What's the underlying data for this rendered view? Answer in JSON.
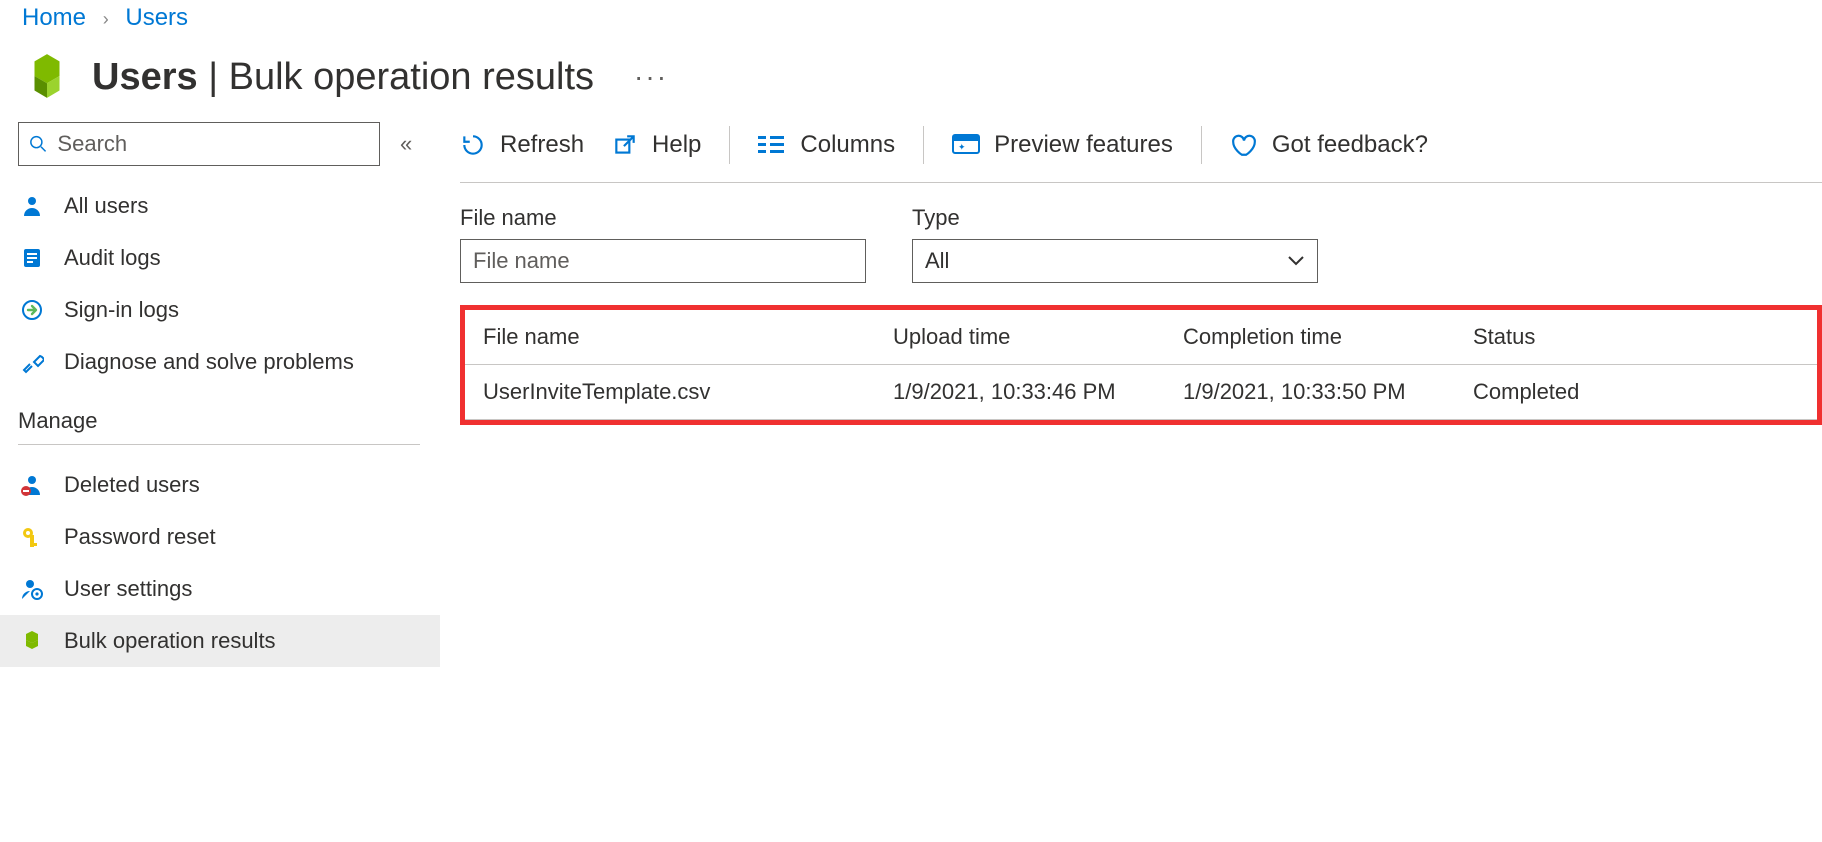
{
  "breadcrumb": {
    "home": "Home",
    "users": "Users"
  },
  "title": {
    "strong": "Users",
    "rest": " | Bulk operation results",
    "more": "···"
  },
  "sidebar": {
    "search_placeholder": "Search",
    "items": {
      "all_users": "All users",
      "audit_logs": "Audit logs",
      "signin_logs": "Sign-in logs",
      "diagnose": "Diagnose and solve problems"
    },
    "manage_header": "Manage",
    "manage": {
      "deleted_users": "Deleted users",
      "password_reset": "Password reset",
      "user_settings": "User settings",
      "bulk_results": "Bulk operation results"
    }
  },
  "toolbar": {
    "refresh": "Refresh",
    "help": "Help",
    "columns": "Columns",
    "preview": "Preview features",
    "feedback": "Got feedback?"
  },
  "filters": {
    "file_label": "File name",
    "file_placeholder": "File name",
    "type_label": "Type",
    "type_value": "All"
  },
  "table": {
    "headers": {
      "file": "File name",
      "upload": "Upload time",
      "completion": "Completion time",
      "status": "Status"
    },
    "rows": [
      {
        "file": "UserInviteTemplate.csv",
        "upload": "1/9/2021, 10:33:46 PM",
        "completion": "1/9/2021, 10:33:50 PM",
        "status": "Completed"
      }
    ]
  }
}
